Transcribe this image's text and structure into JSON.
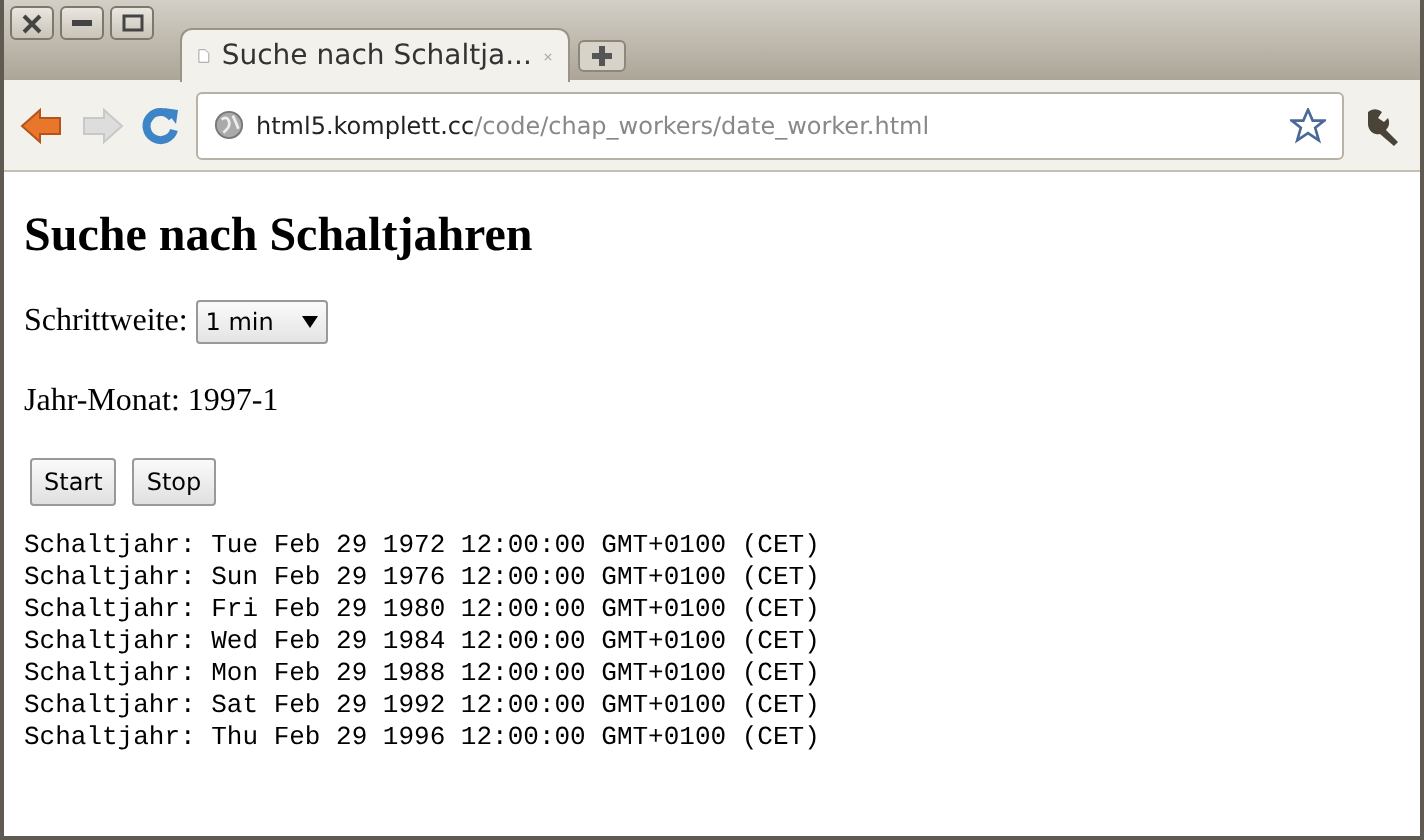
{
  "tabs": [
    {
      "title": "Suche nach Schaltja...",
      "selected": true
    }
  ],
  "address_bar": {
    "host": "html5.komplett.cc",
    "path": "/code/chap_workers/date_worker.html"
  },
  "page": {
    "heading": "Suche nach Schaltjahren",
    "step": {
      "label": "Schrittweite:",
      "value": "1 min"
    },
    "progress": "Jahr-Monat: 1997-1",
    "buttons": [
      "Start",
      "Stop"
    ],
    "results": [
      "Schaltjahr: Tue Feb 29 1972 12:00:00 GMT+0100 (CET)",
      "Schaltjahr: Sun Feb 29 1976 12:00:00 GMT+0100 (CET)",
      "Schaltjahr: Fri Feb 29 1980 12:00:00 GMT+0100 (CET)",
      "Schaltjahr: Wed Feb 29 1984 12:00:00 GMT+0100 (CET)",
      "Schaltjahr: Mon Feb 29 1988 12:00:00 GMT+0100 (CET)",
      "Schaltjahr: Sat Feb 29 1992 12:00:00 GMT+0100 (CET)",
      "Schaltjahr: Thu Feb 29 1996 12:00:00 GMT+0100 (CET)"
    ]
  }
}
